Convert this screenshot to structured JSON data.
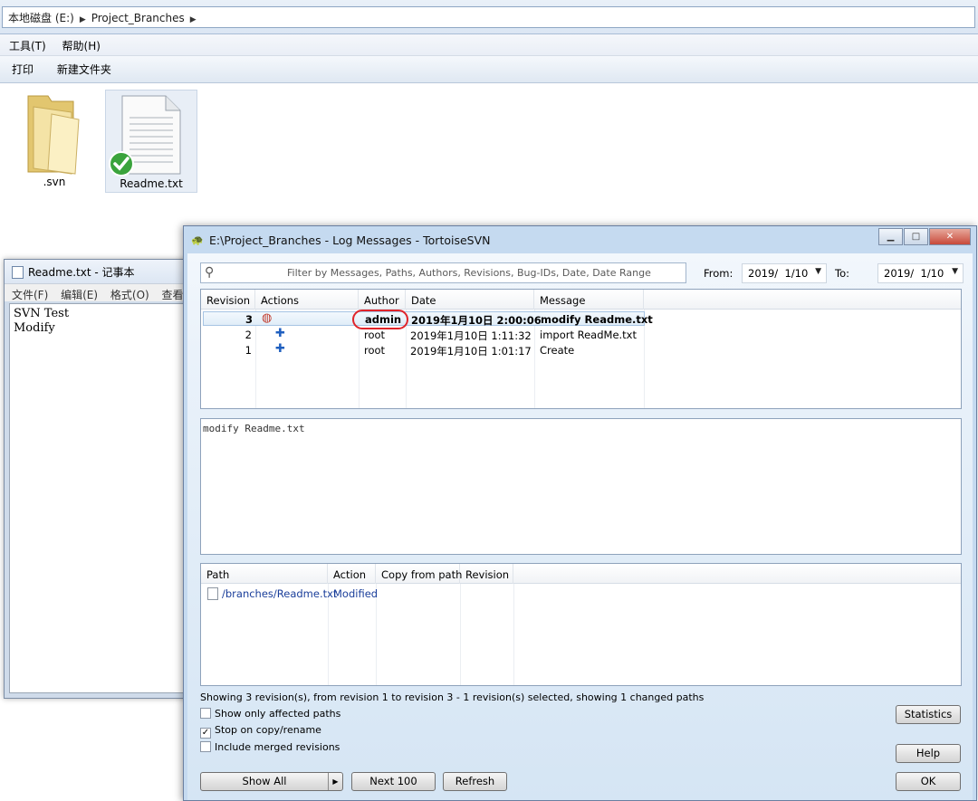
{
  "explorer": {
    "breadcrumb": [
      "本地磁盘 (E:)",
      "Project_Branches"
    ],
    "menu": [
      "工具(T)",
      "帮助(H)"
    ],
    "toolbar": [
      "打印",
      "新建文件夹"
    ],
    "files": [
      {
        "name": ".svn",
        "icon": "folder-icon"
      },
      {
        "name": "Readme.txt",
        "icon": "text-file-icon",
        "overlay": "svn-normal-checkmark"
      }
    ]
  },
  "notepad": {
    "title": "Readme.txt - 记事本",
    "menu": [
      "文件(F)",
      "编辑(E)",
      "格式(O)",
      "查看("
    ],
    "content": "SVN Test\nModify"
  },
  "svn_log": {
    "title": "E:\\Project_Branches - Log Messages - TortoiseSVN",
    "filter_placeholder": "Filter by Messages, Paths, Authors, Revisions, Bug-IDs, Date, Date Range",
    "from_label": "From:",
    "from_value": "2019/  1/10",
    "to_label": "To:",
    "to_value": "2019/  1/10",
    "columns": [
      "Revision",
      "Actions",
      "Author",
      "Date",
      "Message"
    ],
    "revisions": [
      {
        "revision": "3",
        "author": "admin",
        "date": "2019年1月10日 2:00:06",
        "message": "modify Readme.txt",
        "action_icon": "modified-icon",
        "selected": true
      },
      {
        "revision": "2",
        "author": "root",
        "date": "2019年1月10日 1:11:32",
        "message": "import ReadMe.txt",
        "action_icon": "added-icon",
        "selected": false
      },
      {
        "revision": "1",
        "author": "root",
        "date": "2019年1月10日 1:01:17",
        "message": "Create",
        "action_icon": "added-icon",
        "selected": false
      }
    ],
    "message_text": "modify Readme.txt",
    "path_columns": [
      "Path",
      "Action",
      "Copy from path",
      "Revision"
    ],
    "paths": [
      {
        "path": "/branches/Readme.txt",
        "action": "Modified"
      }
    ],
    "status": "Showing 3 revision(s), from revision 1 to revision 3 - 1 revision(s) selected, showing 1 changed paths",
    "options": [
      {
        "label": "Show only affected paths",
        "checked": false
      },
      {
        "label": "Stop on copy/rename",
        "checked": true
      },
      {
        "label": "Include merged revisions",
        "checked": false
      }
    ],
    "buttons": {
      "show_all": "Show All",
      "next_100": "Next 100",
      "refresh": "Refresh",
      "statistics": "Statistics",
      "help": "Help",
      "ok": "OK"
    },
    "accent_color": "#e0242a"
  }
}
